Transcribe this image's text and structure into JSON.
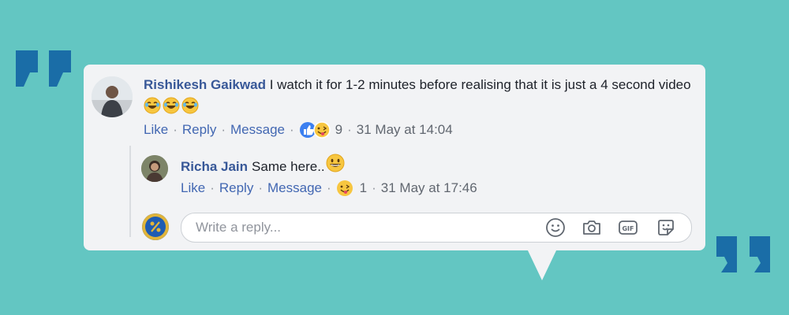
{
  "comment": {
    "author": "Rishikesh Gaikwad",
    "text": "I watch it for 1-2 minutes before realising that it is just a 4 second video",
    "actions": {
      "like": "Like",
      "reply": "Reply",
      "message": "Message"
    },
    "reaction_count": "9",
    "timestamp": "31 May at 14:04"
  },
  "reply": {
    "author": "Richa Jain",
    "text": "Same here..",
    "actions": {
      "like": "Like",
      "reply": "Reply",
      "message": "Message"
    },
    "reaction_count": "1",
    "timestamp": "31 May at 17:46"
  },
  "composer": {
    "placeholder": "Write a reply..."
  },
  "colors": {
    "background": "#63c6c2",
    "quote": "#1a6da7",
    "link": "#4267b2",
    "author": "#385898"
  }
}
